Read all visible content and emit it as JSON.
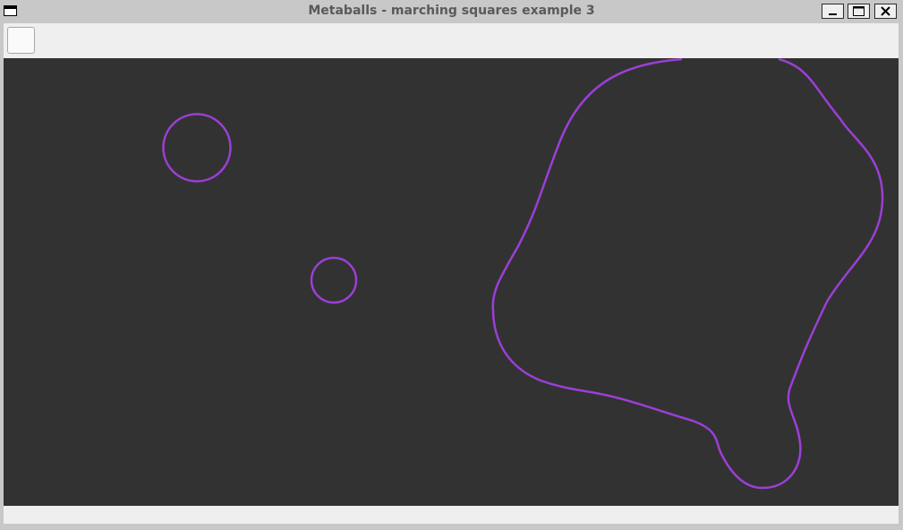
{
  "window": {
    "title": "Metaballs - marching squares example 3"
  },
  "toolbar": {
    "button_label": ""
  },
  "canvas": {
    "background_color": "#323232",
    "contour_color": "#9b3fd6"
  },
  "statusbar": {
    "text": ""
  }
}
